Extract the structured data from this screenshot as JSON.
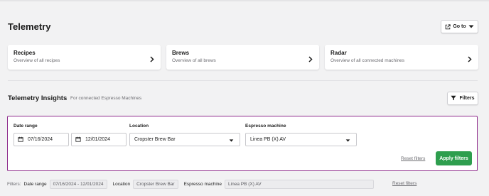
{
  "header": {
    "title": "Telemetry",
    "goto_label": "Go to"
  },
  "cards": [
    {
      "title": "Recipes",
      "subtitle": "Overview of all recipes"
    },
    {
      "title": "Brews",
      "subtitle": "Overview of all brews"
    },
    {
      "title": "Radar",
      "subtitle": "Overview of all connected machines"
    }
  ],
  "insights": {
    "title": "Telemetry Insights",
    "subtitle": "For connected Espresso Machines",
    "filters_label": "Filters"
  },
  "filter_panel": {
    "date_range_label": "Date range",
    "date_from": "07/16/2024",
    "date_to": "12/01/2024",
    "location_label": "Location",
    "location_value": "Cropster Brew Bar",
    "machine_label": "Espresso machine",
    "machine_value": "Linea PB (X) AV",
    "reset_label": "Reset filters",
    "apply_label": "Apply filters"
  },
  "summary": {
    "filters_label": "Filters:",
    "date_range_label": "Date range",
    "date_range_value": "07/16/2024 - 12/01/2024",
    "location_label": "Location",
    "location_value": "Cropster Brew Bar",
    "machine_label": "Espresso machine",
    "machine_value": "Linea PB (X) AV",
    "reset_label": "Reset filters"
  },
  "colors": {
    "accent_border": "#8e2a8b",
    "apply_button": "#2e9e4e",
    "background": "#f2f2f3"
  },
  "icons": {
    "goto": "external-link-icon",
    "dropdown": "caret-down-icon",
    "chevron": "chevron-right-icon",
    "filter": "filter-icon",
    "calendar": "calendar-icon"
  }
}
